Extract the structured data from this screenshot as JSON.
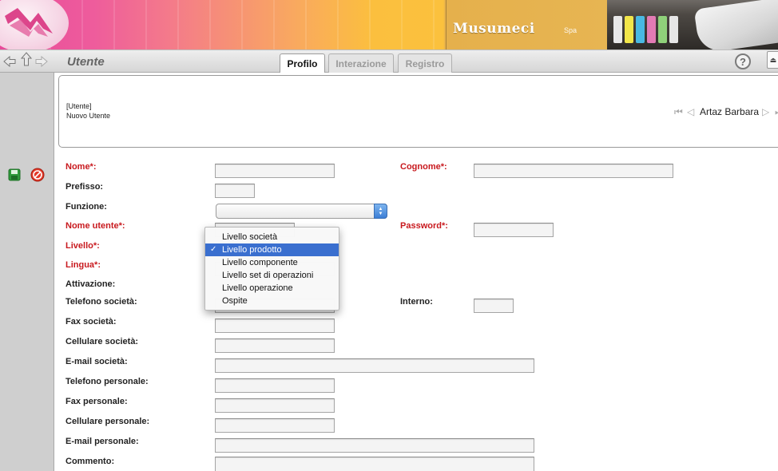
{
  "banner": {
    "brand": "Musumeci",
    "brand_suffix": "Spa"
  },
  "toolbar": {
    "title": "Utente",
    "tabs": [
      {
        "label": "Profilo",
        "active": true
      },
      {
        "label": "Interazione",
        "active": false
      },
      {
        "label": "Registro",
        "active": false
      }
    ],
    "help_label": "?"
  },
  "header": {
    "breadcrumb_parent": "[Utente]",
    "breadcrumb_current": "Nuovo Utente",
    "record_name": "Artaz Barbara"
  },
  "form": {
    "nome": "Nome*:",
    "cognome": "Cognome*:",
    "prefisso": "Prefisso:",
    "funzione": "Funzione:",
    "nome_utente": "Nome utente*:",
    "password": "Password*:",
    "livello": "Livello*:",
    "lingua": "Lingua*:",
    "attivazione": "Attivazione:",
    "telefono_societa": "Telefono società:",
    "interno": "Interno:",
    "fax_societa": "Fax società:",
    "cellulare_societa": "Cellulare società:",
    "email_societa": "E-mail società:",
    "telefono_personale": "Telefono personale:",
    "fax_personale": "Fax personale:",
    "cellulare_personale": "Cellulare personale:",
    "email_personale": "E-mail personale:",
    "commento": "Commento:"
  },
  "livello_menu": {
    "items": [
      {
        "label": "Livello società",
        "selected": false
      },
      {
        "label": "Livello prodotto",
        "selected": true
      },
      {
        "label": "Livello componente",
        "selected": false
      },
      {
        "label": "Livello set di operazioni",
        "selected": false
      },
      {
        "label": "Livello operazione",
        "selected": false
      },
      {
        "label": "Ospite",
        "selected": false
      }
    ],
    "check_mark": "✓"
  },
  "colors": {
    "required_label": "#c8191e",
    "menu_highlight": "#3a6fcf",
    "side_panel": "#cfcfcf"
  },
  "icons": [
    "back-arrow-icon",
    "up-arrow-icon",
    "forward-arrow-icon",
    "save-icon",
    "cancel-icon",
    "help-icon",
    "first-record-icon",
    "prev-record-icon",
    "next-record-icon",
    "last-record-icon"
  ]
}
